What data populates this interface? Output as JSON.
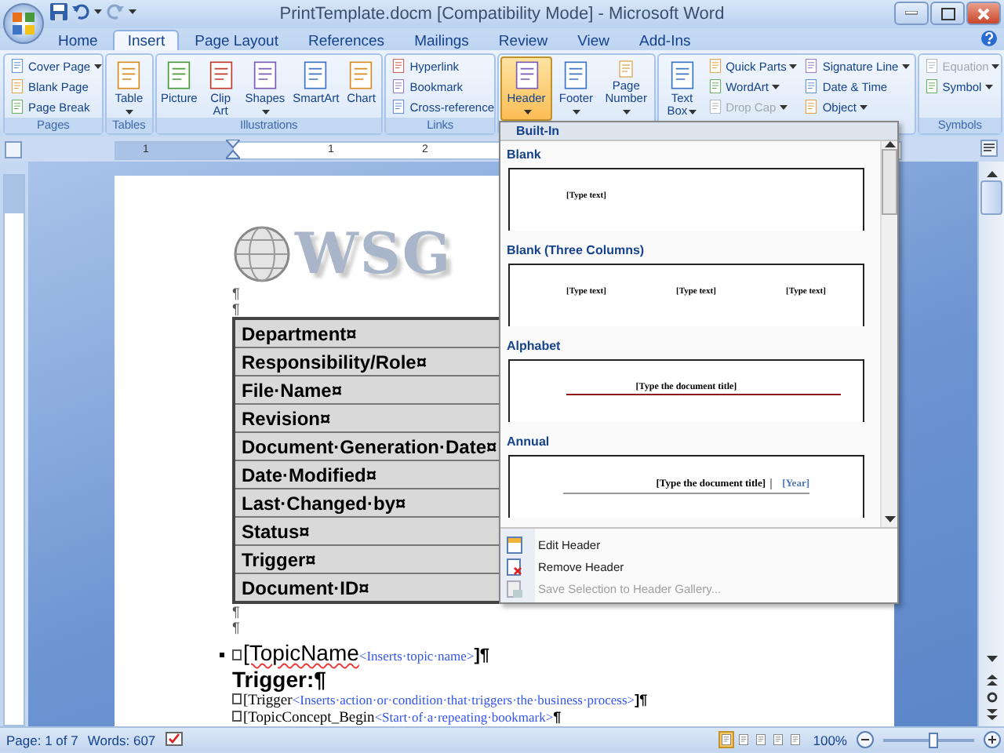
{
  "window": {
    "title": "PrintTemplate.docm [Compatibility Mode] - Microsoft Word"
  },
  "tabs": [
    {
      "label": "Home",
      "selected": false
    },
    {
      "label": "Insert",
      "selected": true
    },
    {
      "label": "Page Layout",
      "selected": false
    },
    {
      "label": "References",
      "selected": false
    },
    {
      "label": "Mailings",
      "selected": false
    },
    {
      "label": "Review",
      "selected": false
    },
    {
      "label": "View",
      "selected": false
    },
    {
      "label": "Add-Ins",
      "selected": false
    }
  ],
  "ribbon": {
    "groups": [
      {
        "label": "Pages",
        "items": [
          {
            "label": "Cover Page",
            "kind": "small",
            "menu": true
          },
          {
            "label": "Blank Page",
            "kind": "small",
            "menu": false
          },
          {
            "label": "Page Break",
            "kind": "small",
            "menu": false
          }
        ]
      },
      {
        "label": "Tables",
        "items": [
          {
            "label": "Table",
            "kind": "large",
            "menu": true
          }
        ]
      },
      {
        "label": "Illustrations",
        "items": [
          {
            "label": "Picture",
            "kind": "large",
            "menu": false
          },
          {
            "label": "Clip Art",
            "kind": "large",
            "menu": false
          },
          {
            "label": "Shapes",
            "kind": "large",
            "menu": true
          },
          {
            "label": "SmartArt",
            "kind": "large",
            "menu": false
          },
          {
            "label": "Chart",
            "kind": "large",
            "menu": false
          }
        ]
      },
      {
        "label": "Links",
        "items": [
          {
            "label": "Hyperlink",
            "kind": "small",
            "menu": false
          },
          {
            "label": "Bookmark",
            "kind": "small",
            "menu": false
          },
          {
            "label": "Cross-reference",
            "kind": "small",
            "menu": false
          }
        ]
      },
      {
        "items": [
          {
            "label": "Header",
            "kind": "large",
            "menu": true,
            "pressed": true
          },
          {
            "label": "Footer",
            "kind": "large",
            "menu": true,
            "pressed": false
          },
          {
            "label": "Page Number",
            "kind": "large",
            "menu": true,
            "pressed": false
          }
        ]
      },
      {
        "items": [
          {
            "label": "Text Box",
            "kind": "large",
            "menu": true,
            "disabled": false
          },
          {
            "label": "Quick Parts",
            "kind": "small",
            "menu": true,
            "disabled": false
          },
          {
            "label": "WordArt",
            "kind": "small",
            "menu": true,
            "disabled": false
          },
          {
            "label": "Drop Cap",
            "kind": "small",
            "menu": true,
            "disabled": true
          },
          {
            "label": "Signature Line",
            "kind": "small",
            "menu": true,
            "disabled": false
          },
          {
            "label": "Date & Time",
            "kind": "small",
            "menu": false,
            "disabled": false
          },
          {
            "label": "Object",
            "kind": "small",
            "menu": true,
            "disabled": false
          }
        ]
      },
      {
        "label": "Symbols",
        "items": [
          {
            "label": "Equation",
            "kind": "small",
            "menu": true,
            "disabled": true
          },
          {
            "label": "Symbol",
            "kind": "small",
            "menu": true,
            "disabled": false
          }
        ]
      }
    ]
  },
  "ruler": {
    "labels": [
      "1",
      "1",
      "2"
    ]
  },
  "document": {
    "blocks": [
      {
        "kind": "logo",
        "text": "WSG"
      },
      {
        "kind": "para",
        "text": "¶"
      },
      {
        "kind": "para",
        "text": "¶"
      },
      {
        "kind": "table",
        "rows": [
          "Department¤",
          "Responsibility/Role¤",
          "File·Name¤",
          "Revision¤",
          "Document·Generation·Date¤",
          "Date·Modified¤",
          "Last·Changed·by¤",
          "Status¤",
          "Trigger¤",
          "Document·ID¤"
        ]
      },
      {
        "kind": "para",
        "text": "¶"
      },
      {
        "kind": "para",
        "text": "¶"
      },
      {
        "kind": "topic",
        "text": "[TopicName",
        "hint": "<Inserts·topic·name>",
        "end": "]¶"
      },
      {
        "kind": "heading",
        "text": "Trigger:¶"
      },
      {
        "kind": "field",
        "text": "[Trigger",
        "hint": "<Inserts·action·or·condition·that·triggers·the·business·process>",
        "end": "]¶"
      },
      {
        "kind": "field",
        "text": "[TopicConcept_Begin",
        "hint": "<Start·of·a·repeating·bookmark>",
        "end": "¶"
      }
    ]
  },
  "header_gallery": {
    "section": "Built-In",
    "templates": [
      {
        "name": "Blank",
        "kind": "blank",
        "texts": [
          "[Type text]"
        ]
      },
      {
        "name": "Blank (Three Columns)",
        "kind": "columns",
        "texts": [
          "[Type text]",
          "[Type text]",
          "[Type text]"
        ]
      },
      {
        "name": "Alphabet",
        "kind": "ruled",
        "texts": [
          "[Type the document title]"
        ]
      },
      {
        "name": "Annual",
        "kind": "annual",
        "texts": [
          "[Type the document title]",
          "[Year]"
        ]
      }
    ],
    "menu": [
      {
        "label": "Edit Header",
        "disabled": false
      },
      {
        "label": "Remove Header",
        "disabled": false
      },
      {
        "label": "Save Selection to Header Gallery...",
        "disabled": true
      }
    ]
  },
  "status_bar": {
    "page": "Page: 1 of 7",
    "words": "Words: 607",
    "views": [
      {
        "selected": true
      },
      {
        "selected": false
      },
      {
        "selected": false
      },
      {
        "selected": false
      },
      {
        "selected": false
      }
    ],
    "zoom": "100%",
    "zoom_slider": {
      "level": 0.5
    }
  }
}
